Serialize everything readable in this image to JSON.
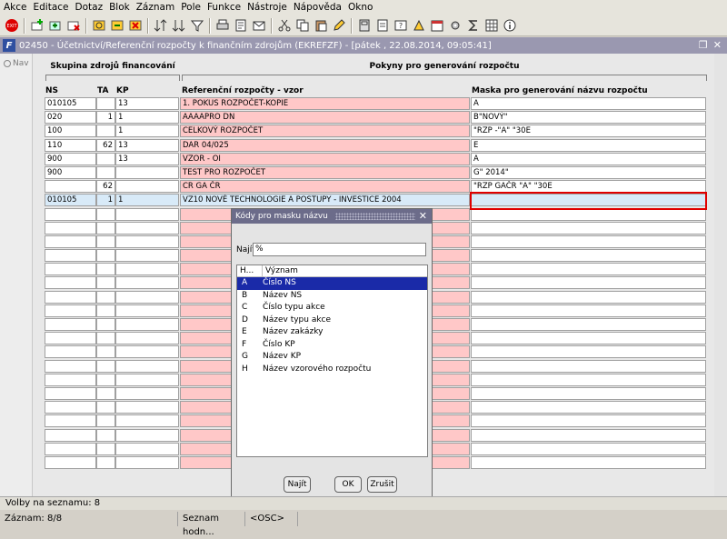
{
  "menu": [
    "Akce",
    "Editace",
    "Dotaz",
    "Blok",
    "Záznam",
    "Pole",
    "Funkce",
    "Nástroje",
    "Nápověda",
    "Okno"
  ],
  "window": {
    "title": "02450 - Účetnictví/Referenční rozpočty k finančním zdrojům (EKREFZF) - [pátek , 22.08.2014, 09:05:41]"
  },
  "nav_label": "Nav",
  "groups": {
    "left": "Skupina zdrojů financování",
    "right": "Pokyny pro generování rozpočtu"
  },
  "columns": {
    "ns": "NS",
    "ta": "TA",
    "kp": "KP",
    "ref": "Referenční rozpočty - vzor",
    "mask": "Maska pro generování názvu rozpočtu"
  },
  "rows": [
    {
      "ns": "010105",
      "ta": "",
      "kp": "13",
      "ref": "1. POKUS ROZPOČET-KOPIE",
      "mask": "A"
    },
    {
      "ns": "020",
      "ta": "1",
      "kp": "1",
      "ref": "AAAAPRO DN",
      "mask": "B\"NOVÝ\""
    },
    {
      "ns": "100",
      "ta": "",
      "kp": "1",
      "ref": "CELKOVÝ ROZPOČET",
      "mask": "\"RZP -\"A\" \"30E"
    },
    {
      "ns": "110",
      "ta": "62",
      "kp": "13",
      "ref": "DAR 04/025",
      "mask": "E"
    },
    {
      "ns": "900",
      "ta": "",
      "kp": "13",
      "ref": "VZOR - OI",
      "mask": "A"
    },
    {
      "ns": "900",
      "ta": "",
      "kp": "",
      "ref": "TEST PRO ROZPOČET",
      "mask": "G\" 2014\""
    },
    {
      "ns": "",
      "ta": "62",
      "kp": "",
      "ref": "CR GA ČR",
      "mask": "\"RZP GAČR \"A\" \"30E"
    },
    {
      "ns": "010105",
      "ta": "1",
      "kp": "1",
      "ref": "VZ10 NOVÉ TECHNOLOGIE A POSTUPY - INVESTICE 2004",
      "mask": ""
    }
  ],
  "dialog": {
    "title": "Kódy pro masku názvu",
    "find_label": "Najít",
    "find_value": "%",
    "col_code": "H...",
    "col_meaning": "Význam",
    "items": [
      {
        "code": "A",
        "meaning": "Číslo NS"
      },
      {
        "code": "B",
        "meaning": "Název NS"
      },
      {
        "code": "C",
        "meaning": "Číslo typu akce"
      },
      {
        "code": "D",
        "meaning": "Název typu akce"
      },
      {
        "code": "E",
        "meaning": "Název zakázky"
      },
      {
        "code": "F",
        "meaning": "Číslo KP"
      },
      {
        "code": "G",
        "meaning": "Název KP"
      },
      {
        "code": "H",
        "meaning": "Název vzorového rozpočtu"
      }
    ],
    "btn_find": "Najít",
    "btn_ok": "OK",
    "btn_cancel": "Zrušit"
  },
  "status": {
    "line1": "Volby na seznamu: 8",
    "record": "Záznam: 8/8",
    "list": "Seznam hodn...",
    "osc": "<OSC>"
  },
  "colors": {
    "ref_bg": "#ffc8c8",
    "selection": "#1a2aa8",
    "highlight": "#e00000"
  }
}
